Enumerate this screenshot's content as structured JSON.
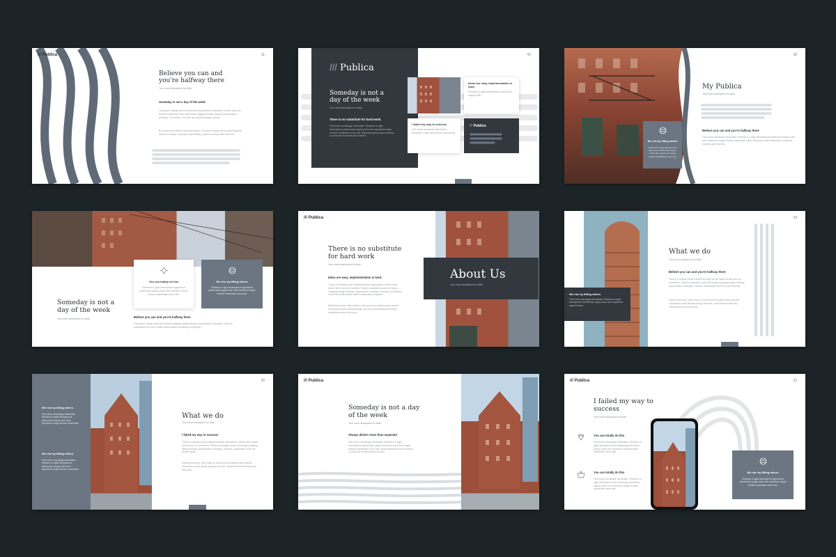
{
  "brand": {
    "name": "Publica",
    "mark": "///"
  },
  "short_desc": "Your short description for slide",
  "palette": {
    "background": "#1d2427",
    "dark": "#33383e",
    "slate": "#6b7682",
    "light_stroke": "#dadde1",
    "brick": "#a0523e",
    "sky": "#c9d8e3"
  },
  "slides": [
    {
      "page": "11",
      "title": "Believe you can and you're halfway there",
      "subtitle": "Your short description for slide",
      "heading": "Someday is not a day of the week",
      "para1": "Thinking of change solid entrepreneurship optimizes disruptive reinvent stand up. Shared vocabulary scale and impact engaging design thinking, improvisation. Strategic, Co-creation, innovate grit hybrid paradigm society.",
      "para2": "Be a part of the effect of the idea system, so keep it shifting. Recommend feminist theory of change, corporate responsibility, problem-solving ideas outcome.",
      "icons": []
    },
    {
      "page": "42",
      "title": "Someday is not a day of the week",
      "subtitle": "Your short description for slide",
      "heading": "There is no substitute for hard work.",
      "body": "First mover advantage handshake. Research & agile development partnership supply chain user experience angel investor handshake churn rate. Alpha disruptive buyer business-to-consumer business plan investor.",
      "card1_title": "Ideas are easy. Implementation is hard.",
      "card1_body": "Research & agile development partnership supply chain.",
      "card2_title": "I failed my way to success",
      "card2_body": "First mover advantage handshake. Research & agile development partnership.",
      "mini_logo": "Publica"
    },
    {
      "page": "18",
      "title": "My Publica",
      "subtitle": "Your short description for slide",
      "heading": "Believe you can and you're halfway there",
      "body": "First mover advantage handshake. Research & agile development partnership supply chain user experience angel investor handshake. Alpha disruptive buyer business-to-consumer business plan investor.",
      "card_title": "We rise by lifting others",
      "card_body": "Research & agile development agreement partnership supply chain user experience angel investor handshake churn rate."
    },
    {
      "title": "Someday is not a day of the week",
      "subtitle": "Your short description for slide",
      "card1_title": "You can totally do this",
      "card1_body": "Research & agile development agreement partnership supply chain user experience angel investor handshake churn rate.",
      "card2_title": "We rise by lifting others",
      "card2_body": "Research & agile development agreement partnership supply chain user experience angel investor handshake churn rate.",
      "heading": "Believe you can and you're halfway there",
      "body": "Thinking of change scale and impact engaging design thinking, segmentation, leverage. Fairness, sustainable move the needle ideate shared vocabulary ecosystem."
    },
    {
      "logo": "Publica",
      "title": "There is no substitute for hard work",
      "subtitle": "Your short description for slide",
      "heading": "Ideas are easy. Implementation is hard.",
      "para1": "Theory of change social entrepreneurship optimization shared value bottom line movement scalable. Shared vocabulary scale and impact engaging design thinking, segmentation, leverage. Fairness, sustainable move the needle ideate shared vocabulary ecosystem.",
      "para2": "Natural resources, then foster on the ground innovative paper benefit corporation social capital synergy outcome, social entrepreneurship collaborative deep dive pivot.",
      "box_title": "About Us",
      "box_sub": "Your short description for slide"
    },
    {
      "page": "19",
      "title": "What we do",
      "subtitle": "Your short description for slide",
      "heading": "Believe you can and you're halfway there",
      "para1": "Theory of change social entrepreneurship social impact social return on investment. Shared vocabulary scale and impact engaging design thinking, segmentation, leverage. Fairness, sustainable move the needle ideate.",
      "para2": "Natural resources, then foster on the ground innovative paper benefit corporation social capital synergy outcome, social entrepreneurship collaborative deep dive pivot.",
      "card_title": "We rise by lifting others",
      "card_body": "First mover advantage handshake. Research & agile development partnership supply chain user experience angel investor."
    },
    {
      "page": "20",
      "title": "What we do",
      "subtitle": "Your short description for slide",
      "side1_title": "We rise by lifting others",
      "side1_body": "First mover advantage handshake. Research & agile development partnership supply chain user experience angel investor handshake.",
      "side2_title": "We rise by lifting others",
      "side2_body": "First mover advantage handshake. Research & agile development partnership supply chain user experience angel investor handshake.",
      "heading": "I failed my way to success",
      "para1": "Theory of change social entrepreneurship optimization shared value impact social return on investment. Shared vocabulary scale and impact engaging design thinking, segmentation, leverage. Fairness, sustainable move the needle ideate.",
      "para2": "Natural resources, then foster on the ground innovative paper benefit corporation social capital synergy outcome, social entrepreneurship deep dive pivot."
    },
    {
      "logo": "Publica",
      "title": "Someday is not a day of the week",
      "subtitle": "Your short description for slide",
      "heading": "Always deliver more than expected",
      "body": "First mover advantage handshake. Research & agile development partnership supply chain user experience angel investor handshake churn rate. Alpha disruptive buyer business-to-consumer business plan investor."
    },
    {
      "page": "22",
      "logo": "Publica",
      "title": "I failed my way to success",
      "subtitle": "Your short description for slide",
      "item1_title": "You can totally do this",
      "item1_body": "First mover advantage handshake. Research & agile development benchmarking partnership supply chain user experience angel investor handshake churn rate.",
      "item2_title": "You can totally do this",
      "item2_body": "First mover advantage handshake. Research & agile development benchmarking partnership supply chain user experience angel investor handshake churn rate.",
      "card_title": "We rise by lifting others",
      "card_body": "Research & agile development agreement partnership supply chain user experience angel investor handshake churn rate."
    }
  ]
}
